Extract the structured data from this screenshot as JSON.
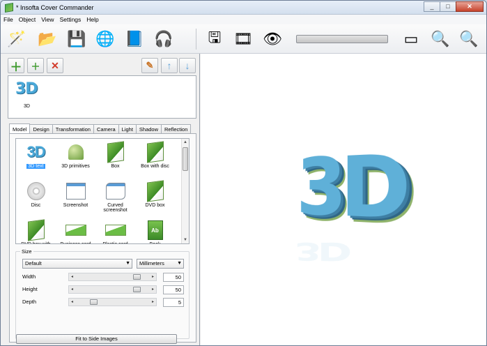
{
  "window": {
    "title": "* Insofta Cover Commander",
    "controls": [
      "_",
      "□",
      "✕"
    ]
  },
  "menu": [
    "File",
    "Object",
    "View",
    "Settings",
    "Help"
  ],
  "toolbar": {
    "left": [
      {
        "name": "wizard-icon",
        "glyph": "🪄"
      },
      {
        "name": "open-icon",
        "glyph": "📂"
      },
      {
        "name": "save-icon",
        "glyph": "💾"
      },
      {
        "name": "web-icon",
        "glyph": "🌐"
      },
      {
        "name": "help-book-icon",
        "glyph": "📘"
      },
      {
        "name": "support-icon",
        "glyph": "🎧"
      }
    ],
    "right": [
      {
        "name": "save-image-icon",
        "glyph": "🖫"
      },
      {
        "name": "film-reel-icon",
        "glyph": "🎞"
      },
      {
        "name": "preview-icon",
        "glyph": "👁"
      }
    ],
    "zoom": [
      {
        "name": "fit-view-icon",
        "glyph": "▭"
      },
      {
        "name": "zoom-in-icon",
        "glyph": "🔍"
      },
      {
        "name": "zoom-out-icon",
        "glyph": "🔍"
      }
    ]
  },
  "layers": {
    "items": [
      {
        "label": "3D"
      }
    ]
  },
  "tabs": [
    "Model",
    "Design",
    "Transformation",
    "Camera",
    "Light",
    "Shadow",
    "Reflection"
  ],
  "gallery": [
    {
      "label": "3D text",
      "kind": "g3d",
      "selected": true
    },
    {
      "label": "3D primitives",
      "kind": "gprim"
    },
    {
      "label": "Box",
      "kind": "gbox"
    },
    {
      "label": "Box with disc",
      "kind": "gbox"
    },
    {
      "label": "Disc",
      "kind": "gdisc"
    },
    {
      "label": "Screenshot",
      "kind": "gshot"
    },
    {
      "label": "Curved screenshot",
      "kind": "gcurve"
    },
    {
      "label": "DVD box",
      "kind": "gbox"
    },
    {
      "label": "DVD box with",
      "kind": "gbox"
    },
    {
      "label": "Business card",
      "kind": "gcard"
    },
    {
      "label": "Plastic card",
      "kind": "gcard"
    },
    {
      "label": "Book",
      "kind": "gbook"
    }
  ],
  "size": {
    "group_label": "Size",
    "preset": "Default",
    "units": "Millimeters",
    "width": {
      "label": "Width",
      "value": "50",
      "level": 0.9
    },
    "height": {
      "label": "Height",
      "value": "50",
      "level": 0.9
    },
    "depth": {
      "label": "Depth",
      "value": "5",
      "level": 0.2
    },
    "fit_button": "Fit to Side Images"
  },
  "canvas": {
    "text": "3D"
  }
}
